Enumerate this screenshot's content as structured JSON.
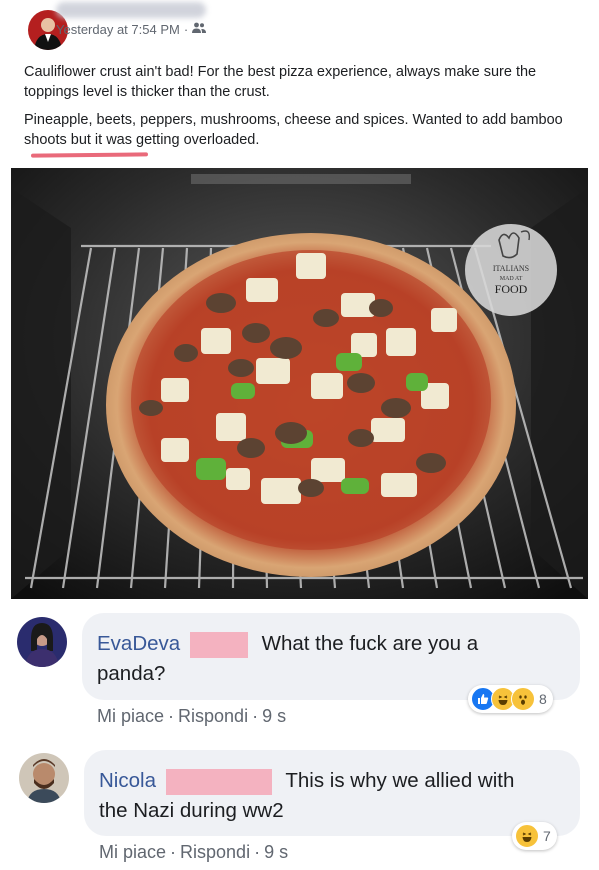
{
  "post": {
    "timestamp": "Yesterday at 7:54 PM",
    "separator": "·",
    "audience_icon": "friends-icon",
    "paragraph1": "Cauliflower crust ain't bad! For the best pizza experience, always make sure the toppings level is thicker than the crust.",
    "paragraph2": "Pineapple, beets, peppers, mushrooms, cheese and spices. Wanted to add bamboo shoots but it was getting overloaded.",
    "highlight_color": "#e96a7a"
  },
  "photo": {
    "watermark_lines": [
      "ITALIANS",
      "MAD AT",
      "FOOD"
    ],
    "watermark_icon": "hand-gesture-icon"
  },
  "comments": [
    {
      "name": "EvaDeva",
      "text_line1": "What the fuck are you a",
      "text_line2": "panda?",
      "like_label": "Mi piace",
      "reply_label": "Rispondi",
      "age": "9 s",
      "dot": "·",
      "reaction_icons": [
        "like-icon",
        "haha-icon",
        "wow-icon"
      ],
      "reaction_count": "8"
    },
    {
      "name": "Nicola",
      "text_line1": "This is why we allied with",
      "text_line2": "the Nazi during ww2",
      "like_label": "Mi piace",
      "reply_label": "Rispondi",
      "age": "9 s",
      "dot": "·",
      "reaction_icons": [
        "haha-icon"
      ],
      "reaction_count": "7"
    }
  ],
  "colors": {
    "name_link": "#385898",
    "redaction": "#f4b2c0",
    "bubble": "#eff1f5",
    "like_blue": "#1877f2",
    "haha_yellow": "#f7c23a"
  }
}
